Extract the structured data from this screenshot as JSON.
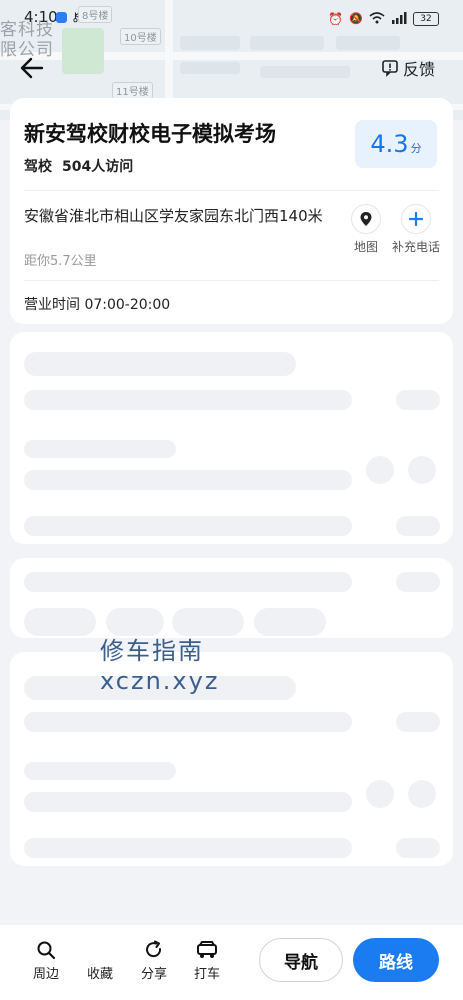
{
  "status_bar": {
    "time": "4:10",
    "battery": "32"
  },
  "map": {
    "watermark_text": "客科技\n限公司",
    "labels": [
      "8号楼",
      "10号楼",
      "11号楼"
    ]
  },
  "header": {
    "feedback_label": "反馈"
  },
  "place": {
    "name": "新安驾校财校电子模拟考场",
    "category": "驾校",
    "visits": "504人访问",
    "rating": "4.3",
    "rating_unit": "分",
    "address": "安徽省淮北市相山区学友家园东北门西140米",
    "distance": "距你5.7公里",
    "hours": "营业时间 07:00-20:00",
    "actions": {
      "map_label": "地图",
      "add_phone_label": "补充电话"
    }
  },
  "overlay_watermark": {
    "line1": "修车指南",
    "line2": "xczn.xyz"
  },
  "bottom_bar": {
    "nearby": "周边",
    "favorite": "收藏",
    "share": "分享",
    "taxi": "打车",
    "navigate": "导航",
    "route": "路线"
  },
  "colors": {
    "accent": "#1b7bf0",
    "rating_bg": "#e8f2fd",
    "skeleton": "#eff1f5",
    "background": "#f2f3f7"
  }
}
